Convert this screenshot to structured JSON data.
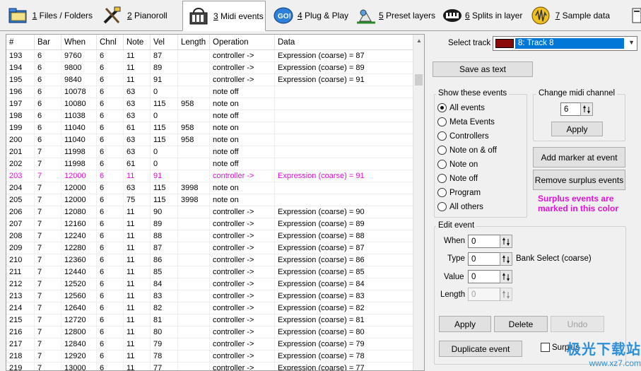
{
  "tabs": [
    {
      "key": "1",
      "label": " Files / Folders",
      "icon": "folder-icon",
      "active": false
    },
    {
      "key": "2",
      "label": " Pianoroll",
      "icon": "pianoroll-icon",
      "active": false
    },
    {
      "key": "3",
      "label": " Midi events",
      "icon": "midi-events-icon",
      "active": true
    },
    {
      "key": "4",
      "label": " Plug & Play",
      "icon": "go-icon",
      "active": false
    },
    {
      "key": "5",
      "label": " Preset layers",
      "icon": "preset-layers-icon",
      "active": false
    },
    {
      "key": "6",
      "label": " Splits in layer",
      "icon": "splits-icon",
      "active": false
    },
    {
      "key": "7",
      "label": " Sample data",
      "icon": "sample-data-icon",
      "active": false
    }
  ],
  "table": {
    "columns": [
      "#",
      "Bar",
      "When",
      "Chnl",
      "Note",
      "Vel",
      "Length",
      "Operation",
      "Data"
    ],
    "rows": [
      [
        "193",
        "6",
        "9760",
        "6",
        "11",
        "87",
        "",
        "controller ->",
        "Expression (coarse) = 87"
      ],
      [
        "194",
        "6",
        "9800",
        "6",
        "11",
        "89",
        "",
        "controller ->",
        "Expression (coarse) = 89"
      ],
      [
        "195",
        "6",
        "9840",
        "6",
        "11",
        "91",
        "",
        "controller ->",
        "Expression (coarse) = 91"
      ],
      [
        "196",
        "6",
        "10078",
        "6",
        "63",
        "0",
        "",
        "note off",
        ""
      ],
      [
        "197",
        "6",
        "10080",
        "6",
        "63",
        "115",
        "958",
        "note on",
        ""
      ],
      [
        "198",
        "6",
        "11038",
        "6",
        "63",
        "0",
        "",
        "note off",
        ""
      ],
      [
        "199",
        "6",
        "11040",
        "6",
        "61",
        "115",
        "958",
        "note on",
        ""
      ],
      [
        "200",
        "6",
        "11040",
        "6",
        "63",
        "115",
        "958",
        "note on",
        ""
      ],
      [
        "201",
        "7",
        "11998",
        "6",
        "63",
        "0",
        "",
        "note off",
        ""
      ],
      [
        "202",
        "7",
        "11998",
        "6",
        "61",
        "0",
        "",
        "note off",
        ""
      ],
      [
        "203",
        "7",
        "12000",
        "6",
        "11",
        "91",
        "",
        "controller ->",
        "Expression (coarse) = 91"
      ],
      [
        "204",
        "7",
        "12000",
        "6",
        "63",
        "115",
        "3998",
        "note on",
        ""
      ],
      [
        "205",
        "7",
        "12000",
        "6",
        "75",
        "115",
        "3998",
        "note on",
        ""
      ],
      [
        "206",
        "7",
        "12080",
        "6",
        "11",
        "90",
        "",
        "controller ->",
        "Expression (coarse) = 90"
      ],
      [
        "207",
        "7",
        "12160",
        "6",
        "11",
        "89",
        "",
        "controller ->",
        "Expression (coarse) = 89"
      ],
      [
        "208",
        "7",
        "12240",
        "6",
        "11",
        "88",
        "",
        "controller ->",
        "Expression (coarse) = 88"
      ],
      [
        "209",
        "7",
        "12280",
        "6",
        "11",
        "87",
        "",
        "controller ->",
        "Expression (coarse) = 87"
      ],
      [
        "210",
        "7",
        "12360",
        "6",
        "11",
        "86",
        "",
        "controller ->",
        "Expression (coarse) = 86"
      ],
      [
        "211",
        "7",
        "12440",
        "6",
        "11",
        "85",
        "",
        "controller ->",
        "Expression (coarse) = 85"
      ],
      [
        "212",
        "7",
        "12520",
        "6",
        "11",
        "84",
        "",
        "controller ->",
        "Expression (coarse) = 84"
      ],
      [
        "213",
        "7",
        "12560",
        "6",
        "11",
        "83",
        "",
        "controller ->",
        "Expression (coarse) = 83"
      ],
      [
        "214",
        "7",
        "12640",
        "6",
        "11",
        "82",
        "",
        "controller ->",
        "Expression (coarse) = 82"
      ],
      [
        "215",
        "7",
        "12720",
        "6",
        "11",
        "81",
        "",
        "controller ->",
        "Expression (coarse) = 81"
      ],
      [
        "216",
        "7",
        "12800",
        "6",
        "11",
        "80",
        "",
        "controller ->",
        "Expression (coarse) = 80"
      ],
      [
        "217",
        "7",
        "12840",
        "6",
        "11",
        "79",
        "",
        "controller ->",
        "Expression (coarse) = 79"
      ],
      [
        "218",
        "7",
        "12920",
        "6",
        "11",
        "78",
        "",
        "controller ->",
        "Expression (coarse) = 78"
      ],
      [
        "219",
        "7",
        "13000",
        "6",
        "11",
        "77",
        "",
        "controller ->",
        "Expression (coarse) = 77"
      ]
    ],
    "surplus_row_index": 10,
    "surplus_color": "#e012d8"
  },
  "panel": {
    "select_track_label": "Select track",
    "select_track_value": "8: Track 8",
    "track_color": "#8b0a0a",
    "save_as_text": "Save as text",
    "show_events": {
      "title": "Show these events",
      "options": [
        "All events",
        "Meta Events",
        "Controllers",
        "Note on & off",
        "Note on",
        "Note off",
        "Program",
        "All others"
      ],
      "selected": 0
    },
    "change_channel": {
      "title": "Change midi channel",
      "value": "6",
      "apply": "Apply"
    },
    "add_marker": "Add marker at event",
    "remove_surplus": "Remove surplus events",
    "surplus_note": "Surplus events are marked in this color",
    "edit_event": {
      "title": "Edit event",
      "when_label": "When",
      "when_value": "0",
      "type_label": "Type",
      "type_value": "0",
      "type_name": "Bank Select (coarse)",
      "value_label": "Value",
      "value_value": "0",
      "length_label": "Length",
      "length_value": "0"
    },
    "apply": "Apply",
    "delete": "Delete",
    "undo": "Undo",
    "duplicate": "Duplicate event",
    "surplus_checkbox": "Surplus"
  },
  "watermark": {
    "line1": "极光下载站",
    "line2": "www.xz7.com"
  }
}
